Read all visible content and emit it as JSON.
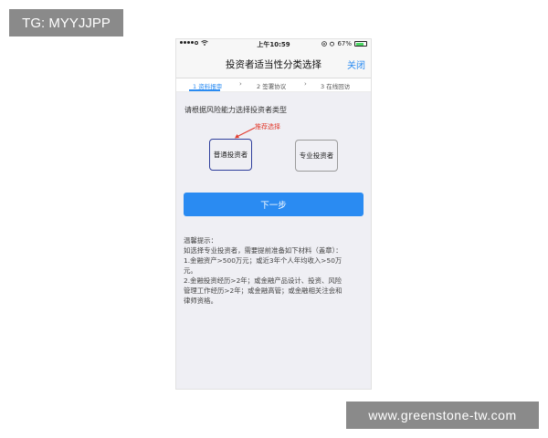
{
  "watermarks": {
    "top": "TG: MYYJJPP",
    "bottom": "www.greenstone-tw.com"
  },
  "status_bar": {
    "time": "上午10:59",
    "battery": "67%"
  },
  "nav": {
    "title": "投资者适当性分类选择",
    "close_label": "关闭"
  },
  "steps": [
    {
      "label": "1 资料报审",
      "active": true
    },
    {
      "label": "2 签署协议",
      "active": false
    },
    {
      "label": "3 在线回访",
      "active": false
    }
  ],
  "content": {
    "prompt": "请根据风险能力选择投资者类型",
    "recommend_label": "推荐选择",
    "investor_types": [
      {
        "label": "普通投资者",
        "selected": true
      },
      {
        "label": "专业投资者",
        "selected": false
      }
    ],
    "next_button": "下一步"
  },
  "tips": {
    "lines": [
      "温馨提示：",
      "如选择专业投资者，需要提前准备如下材料（盖章）：",
      "1.金融资产>500万元；或近3年个人年均收入>50万",
      "元。",
      "2.金融投资经历>2年；或金融产品设计、投资、风险",
      "管理工作经历>2年；或金融高管；或金融相关注会和",
      "律师资格。"
    ]
  },
  "colors": {
    "accent": "#2a8bf2",
    "recommend": "#e23b2e",
    "selected_border": "#2f3f9c",
    "background": "#efeff4"
  }
}
